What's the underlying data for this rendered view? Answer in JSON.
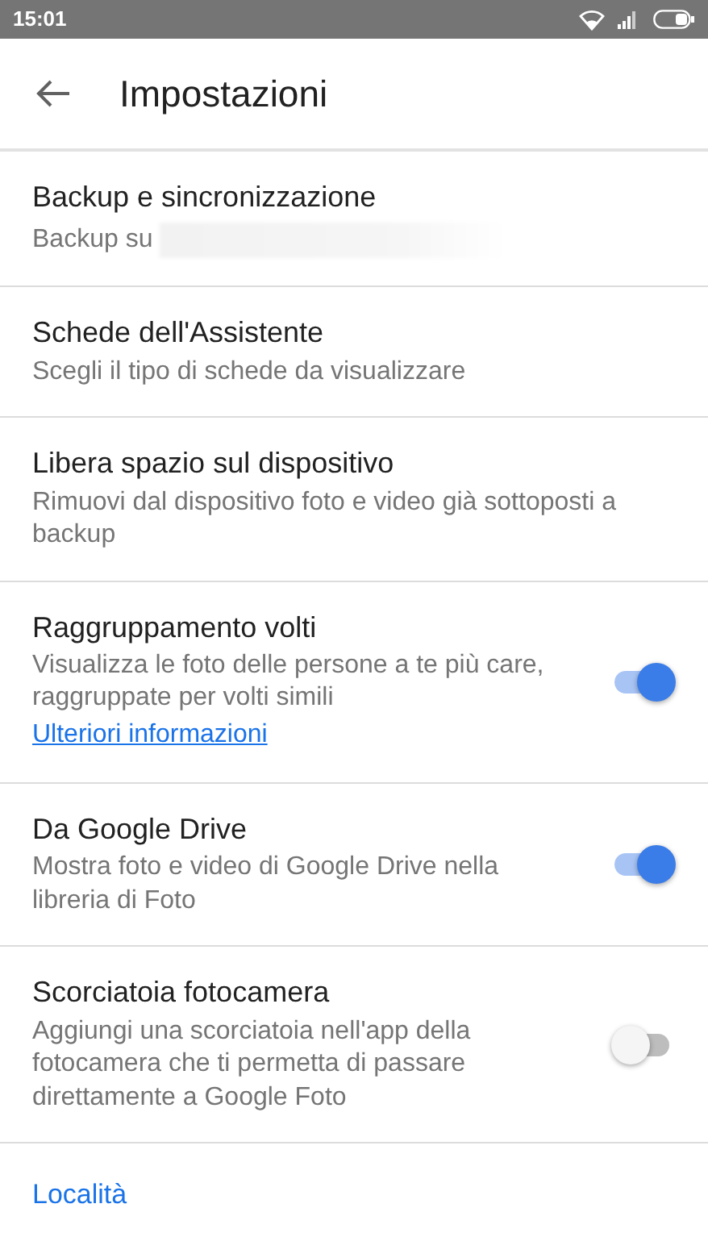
{
  "status_bar": {
    "time": "15:01"
  },
  "app_bar": {
    "title": "Impostazioni"
  },
  "settings": [
    {
      "kind": "text",
      "title": "Backup e sincronizzazione",
      "subtitle": "Backup su",
      "redacted": true
    },
    {
      "kind": "text",
      "title": "Schede dell'Assistente",
      "subtitle": "Scegli il tipo di schede da visualizzare"
    },
    {
      "kind": "text",
      "title": "Libera spazio sul dispositivo",
      "subtitle": "Rimuovi dal dispositivo foto e video già sottoposti a backup"
    },
    {
      "kind": "toggle",
      "title": "Raggruppamento volti",
      "subtitle": "Visualizza le foto delle persone a te più care, raggruppate per volti simili",
      "link": "Ulteriori informazioni",
      "on": true
    },
    {
      "kind": "toggle",
      "title": "Da Google Drive",
      "subtitle": "Mostra foto e video di Google Drive nella libreria di Foto",
      "on": true
    },
    {
      "kind": "toggle",
      "title": "Scorciatoia fotocamera",
      "subtitle": "Aggiungi una scorciatoia nell'app della fotocamera che ti permetta di passare direttamente a Google Foto",
      "on": false
    }
  ],
  "section": {
    "title": "Località"
  }
}
